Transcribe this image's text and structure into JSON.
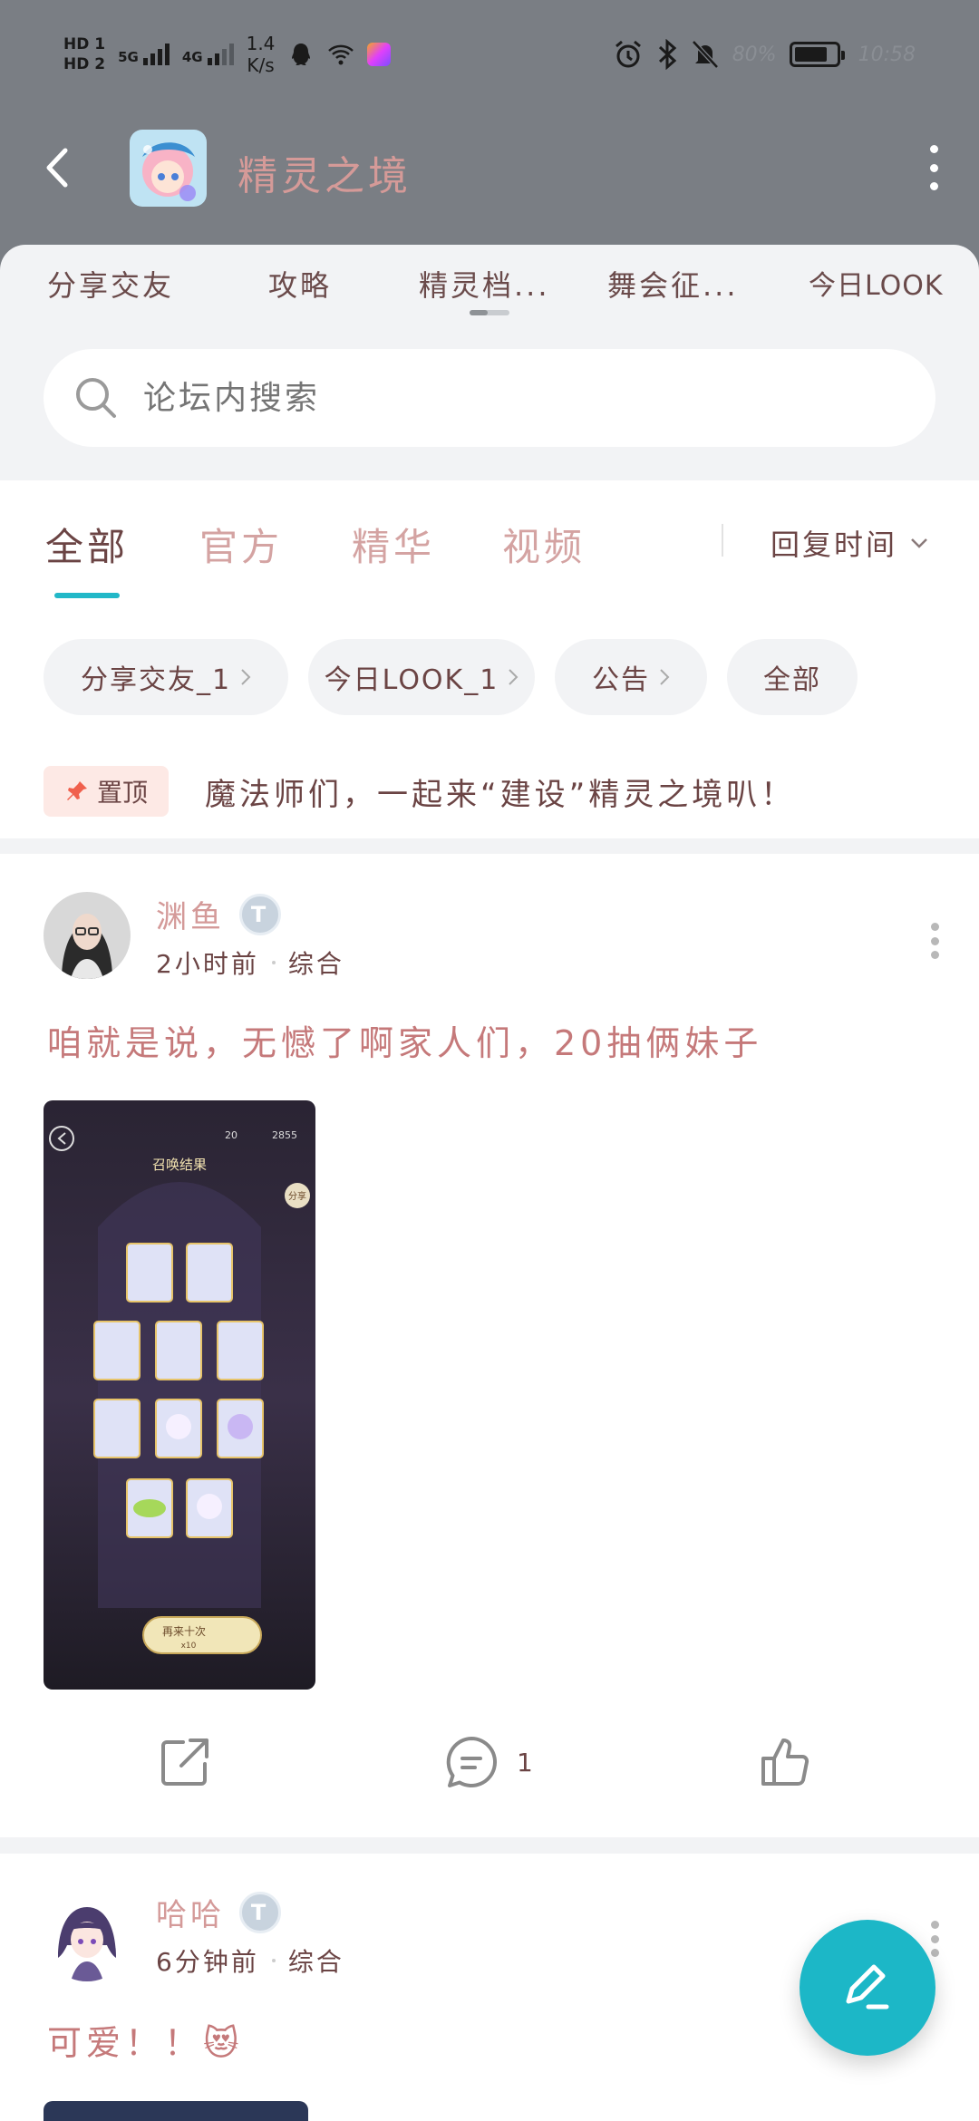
{
  "status_bar": {
    "hd1": "HD 1",
    "hd2": "HD 2",
    "net1": "5G",
    "net2": "4G",
    "speed_value": "1.4",
    "speed_unit": "K/s",
    "battery_percent": "80%",
    "battery_level": 0.8,
    "time": "10:58"
  },
  "nav": {
    "title": "精灵之境"
  },
  "categories": [
    "分享交友",
    "攻略",
    "精灵档...",
    "舞会征...",
    "今日LOOK"
  ],
  "search": {
    "placeholder": "论坛内搜索"
  },
  "filter_tabs": [
    "全部",
    "官方",
    "精华",
    "视频"
  ],
  "sort": {
    "label": "回复时间"
  },
  "chips": [
    "分享交友_1",
    "今日LOOK_1",
    "公告",
    "全部"
  ],
  "pinned": {
    "badge": "置顶",
    "text": "魔法师们，一起来“建设”精灵之境叭！"
  },
  "posts": [
    {
      "username": "渊鱼",
      "level": "T",
      "time": "2小时前",
      "category": "综合",
      "text": "咱就是说，无憾了啊家人们，20抽俩妹子",
      "comment_count": "1",
      "image": {
        "title": "召唤结果",
        "currency1": "20",
        "currency2": "2855",
        "share": "分享",
        "button": "再来十次",
        "cost": "x10"
      }
    },
    {
      "username": "哈哈",
      "level": "T",
      "time": "6分钟前",
      "category": "综合",
      "text": "可爱！！😻"
    }
  ],
  "colors": {
    "header_bg": "#7a7e84",
    "accent": "#1cb7c7",
    "title_pink": "#d59a98",
    "text_brown": "#6b4444"
  }
}
